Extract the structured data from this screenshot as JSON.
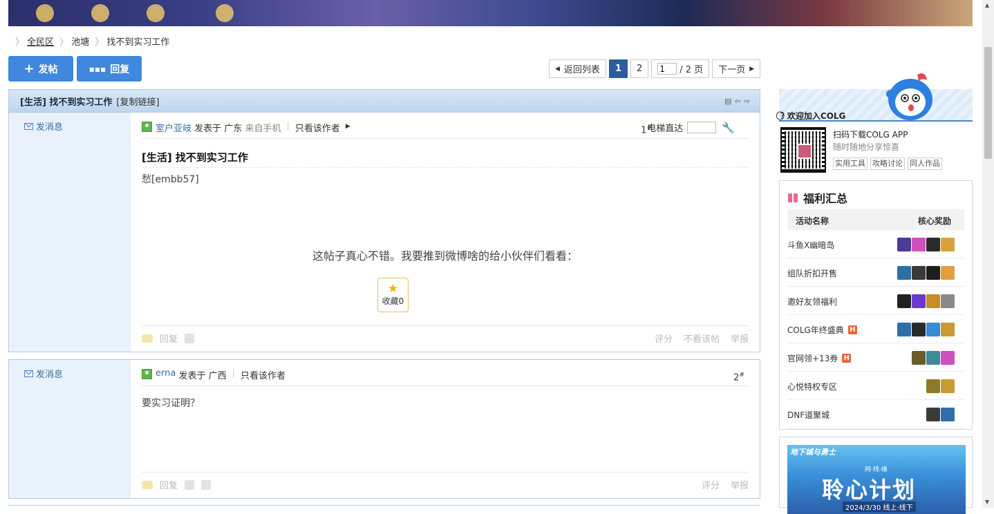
{
  "breadcrumb": [
    "全民区",
    "池塘",
    "找不到实习工作"
  ],
  "buttons": {
    "post": "发帖",
    "reply": "回复"
  },
  "pager": {
    "back": "返回列表",
    "pages": [
      "1",
      "2"
    ],
    "current_input": "1",
    "total": "/ 2 页",
    "next": "下一页"
  },
  "thread": {
    "title": "[生活] 找不到实习工作",
    "copy_link": "[复制链接]"
  },
  "posts": [
    {
      "send_msg": "发消息",
      "author": "室户亚岐",
      "posted_at": "发表于 广东",
      "via": "来自手机",
      "only_author": "只看该作者",
      "floor": "1",
      "lift_label": "电梯直达",
      "title": "[生活] 找不到实习工作",
      "content": "愁[embb57]",
      "share_text": "这帖子真心不错。我要推到微博啥的给小伙伴们看看：",
      "favorite": "收藏0",
      "reply": "回复",
      "rate": "评分",
      "hide_post": "不看该帖",
      "report": "举报"
    },
    {
      "send_msg": "发消息",
      "author": "erna",
      "posted_at": "发表于 广西",
      "only_author": "只看该作者",
      "floor": "2",
      "content": "要实习证明？",
      "reply": "回复",
      "rate": "评分",
      "report": "举报"
    }
  ],
  "sidebar": {
    "app": {
      "title": "欢迎加入COLG",
      "line1": "扫码下载COLG APP",
      "line2": "随时随地分享惊喜",
      "tags": [
        "实用工具",
        "攻略讨论",
        "同人作品"
      ]
    },
    "welfare": {
      "title": "福利汇总",
      "col_name": "活动名称",
      "col_reward": "核心奖励",
      "rows": [
        {
          "name": "斗鱼X幽暗岛",
          "hot": false,
          "icons": [
            "#4a3a9a",
            "#d04fbf",
            "#2a2a2a",
            "#d7a23a"
          ]
        },
        {
          "name": "组队折扣开售",
          "hot": false,
          "icons": [
            "#2e6fa8",
            "#3a3a3a",
            "#1e1e1e",
            "#e0a040"
          ]
        },
        {
          "name": "邀好友领福利",
          "hot": false,
          "icons": [
            "#222222",
            "#6a3ad0",
            "#c98a2a",
            "#8a8a8a"
          ]
        },
        {
          "name": "COLG年终盛典",
          "hot": true,
          "icons": [
            "#2e6fa8",
            "#2a2a2a",
            "#3a8ad8",
            "#c99a30"
          ]
        },
        {
          "name": "官网领+13券",
          "hot": true,
          "icons": [
            "#6b5a2a",
            "#3a8a9a",
            "#d04fbf"
          ]
        },
        {
          "name": "心悦特权专区",
          "hot": false,
          "icons": [
            "#8a7a2a",
            "#c99a30"
          ]
        },
        {
          "name": "DNF道聚城",
          "hot": false,
          "icons": [
            "#3a3a3a",
            "#2e6fa8"
          ]
        }
      ],
      "hot_label": "H"
    },
    "ad": {
      "title": "地下城与勇士",
      "sub": "网·线·缘",
      "big": "聆心计划",
      "date": "2024/3/30 线上·线下"
    }
  },
  "colors": {
    "accent": "#3f88dd",
    "pager_current": "#2c5e9e",
    "header_band": "#bcd6ee",
    "side_panel": "#e9f1fa"
  }
}
